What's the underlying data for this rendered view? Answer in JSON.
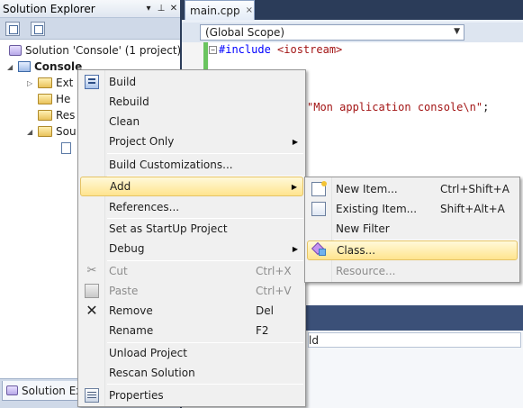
{
  "solution_explorer": {
    "title": "Solution Explorer",
    "header_icons": [
      "dropdown-icon",
      "pin-icon",
      "close-icon"
    ],
    "tree": {
      "solution": "Solution 'Console' (1 project)",
      "project": "Console",
      "items": [
        "Ext",
        "He",
        "Res",
        "Sou"
      ]
    },
    "footer_tab": "Solution Expl"
  },
  "editor": {
    "tab_label": "main.cpp",
    "tab_close": "×",
    "scope": "(Global Scope)",
    "code": {
      "include_directive": "#include",
      "include_target": "<iostream>",
      "string_literal": "\"Mon application console\\n\"",
      "string_suffix": ";"
    }
  },
  "output_panel": {
    "column_fragment": "ld"
  },
  "context_menu": {
    "build": "Build",
    "rebuild": "Rebuild",
    "clean": "Clean",
    "project_only": "Project Only",
    "build_customizations": "Build Customizations...",
    "add": "Add",
    "references": "References...",
    "set_startup": "Set as StartUp Project",
    "debug": "Debug",
    "cut": "Cut",
    "cut_shortcut": "Ctrl+X",
    "paste": "Paste",
    "paste_shortcut": "Ctrl+V",
    "remove": "Remove",
    "remove_shortcut": "Del",
    "rename": "Rename",
    "rename_shortcut": "F2",
    "unload_project": "Unload Project",
    "rescan_solution": "Rescan Solution",
    "properties": "Properties"
  },
  "add_submenu": {
    "new_item": "New Item...",
    "new_item_shortcut": "Ctrl+Shift+A",
    "existing_item": "Existing Item...",
    "existing_item_shortcut": "Shift+Alt+A",
    "new_filter": "New Filter",
    "class": "Class...",
    "resource": "Resource..."
  },
  "colors": {
    "highlight_top": "#fff9d9",
    "highlight_bottom": "#ffe48e",
    "highlight_border": "#e5c365",
    "ide_background": "#2b3c59",
    "preprocessor": "#0000ff",
    "string": "#a31515"
  }
}
